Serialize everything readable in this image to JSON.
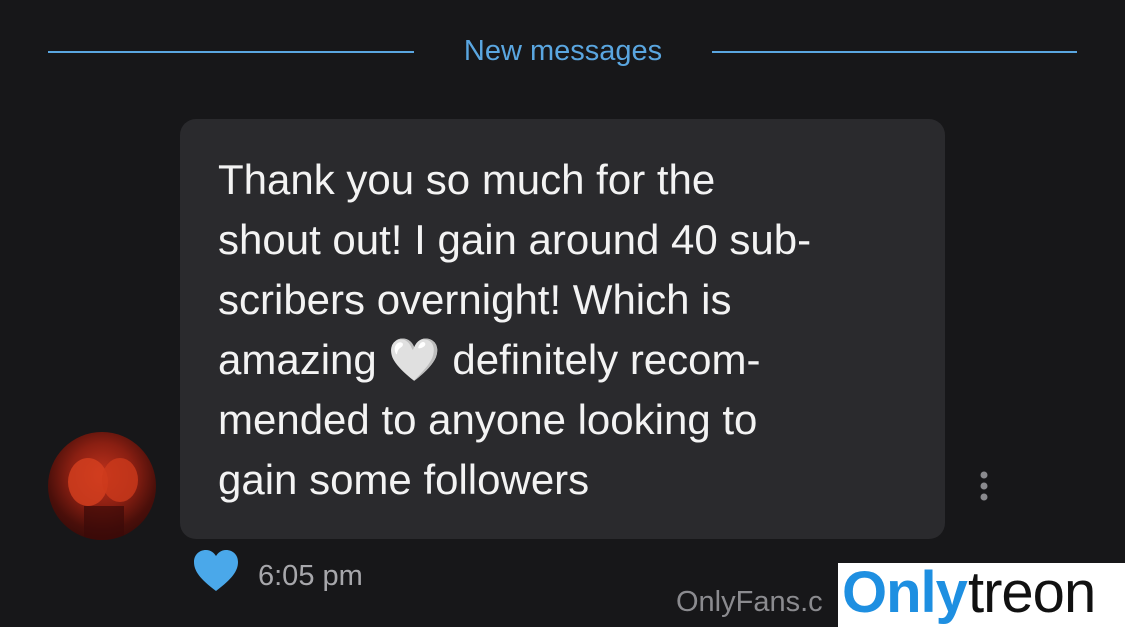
{
  "divider": {
    "label": "New messages"
  },
  "message": {
    "text": "Thank you so much for the\nshout out! I gain around 40 sub-\nscribers overnight! Which is\namazing 🤍 definitely recom-\nmended to anyone looking to\ngain some followers",
    "timestamp": "6:05 pm",
    "liked": true
  },
  "watermark": {
    "site_text": "OnlyFans.c",
    "brand_part1": "Only",
    "brand_part2": "treon"
  },
  "colors": {
    "background": "#171719",
    "accent": "#5aa6e0",
    "bubble": "#2a2a2d",
    "like": "#4aa8ea"
  },
  "icons": {
    "more": "more-vertical-icon",
    "like": "heart-icon"
  }
}
